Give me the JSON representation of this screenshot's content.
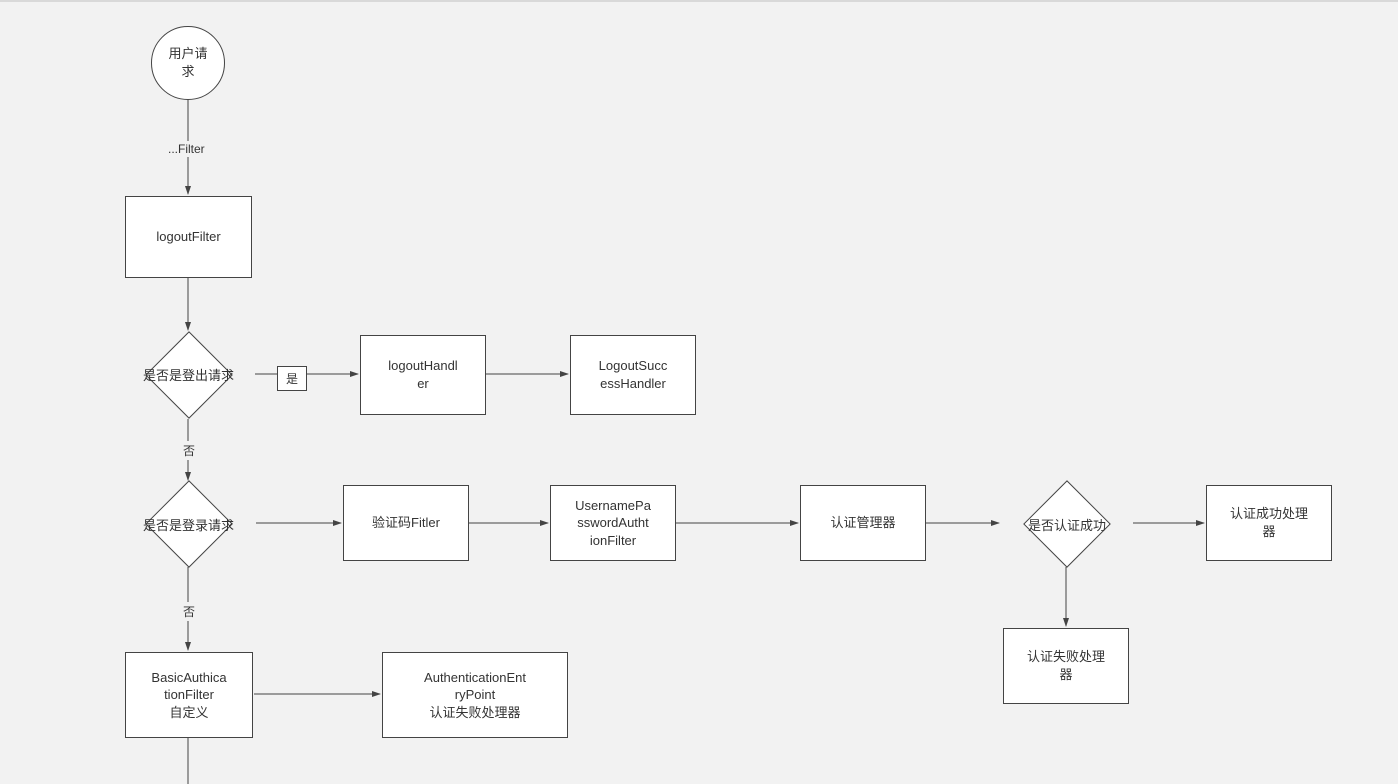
{
  "nodes": {
    "start": "用户请\n求",
    "logoutFilter": "logoutFilter",
    "isLogout": "是否是登出请求",
    "logoutHandler": "logoutHandl\ner",
    "logoutSuccess": "LogoutSucc\nessHandler",
    "isLogin": "是否是登录请求",
    "captchaFilter": "验证码Fitler",
    "upFilter": "UsernamePa\nsswordAutht\nionFilter",
    "authManager": "认证管理器",
    "isAuthOk": "是否认证成功",
    "successHandler": "认证成功处理\n器",
    "failHandler": "认证失败处理\n器",
    "basicFilter": "BasicAuthica\ntionFilter\n自定义",
    "entryPoint": "AuthenticationEnt\nryPoint\n认证失败处理器"
  },
  "edgeLabels": {
    "filter": "...Filter",
    "yes": "是",
    "no1": "否",
    "no2": "否"
  }
}
